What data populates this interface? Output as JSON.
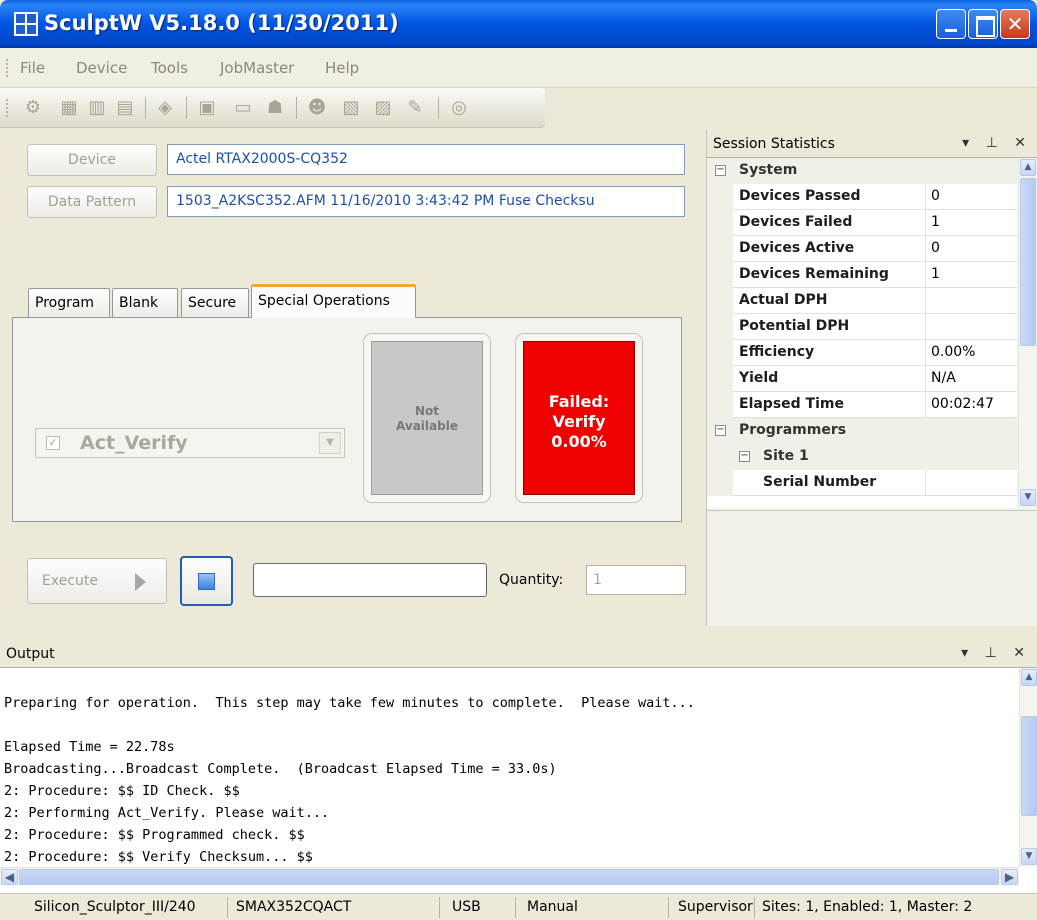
{
  "window": {
    "title": "SculptW  V5.18.0 (11/30/2011)"
  },
  "menu": [
    "File",
    "Device",
    "Tools",
    "JobMaster",
    "Help"
  ],
  "toolbar_icons": [
    "settings-icon",
    "chip-programmer-icon",
    "chip-icon",
    "chip-edit-icon",
    "chip-scan-icon",
    "document-icon",
    "serial-icon",
    "user-icon",
    "operator-icon",
    "open-job-icon",
    "save-job-icon",
    "tools-icon",
    "help-icon"
  ],
  "device": {
    "button_label": "Device",
    "value": "Actel RTAX2000S-CQ352"
  },
  "data_pattern": {
    "button_label": "Data Pattern",
    "value": "1503_A2KSC352.AFM    11/16/2010 3:43:42 PM    Fuse Checksu"
  },
  "tabs": [
    "Program",
    "Blank",
    "Secure",
    "Special Operations"
  ],
  "operation": {
    "selected": "Act_Verify",
    "checked": true
  },
  "cards": {
    "not_available": [
      "Not",
      "Available"
    ],
    "failed": [
      "Failed:",
      "Verify",
      "0.00%"
    ],
    "colors": {
      "failed": "#f10000",
      "not_available": "#c8c8c8"
    }
  },
  "controls": {
    "execute_label": "Execute",
    "quantity_label": "Quantity:",
    "quantity_value": "1",
    "free_text": ""
  },
  "stats": {
    "title": "Session Statistics",
    "system_label": "System",
    "rows": [
      {
        "label": "Devices Passed",
        "value": "0"
      },
      {
        "label": "Devices Failed",
        "value": "1"
      },
      {
        "label": "Devices Active",
        "value": "0"
      },
      {
        "label": "Devices Remaining",
        "value": "1"
      },
      {
        "label": "Actual DPH",
        "value": ""
      },
      {
        "label": "Potential DPH",
        "value": ""
      },
      {
        "label": "Efficiency",
        "value": "0.00%"
      },
      {
        "label": "Yield",
        "value": "N/A"
      },
      {
        "label": "Elapsed Time",
        "value": "00:02:47"
      }
    ],
    "programmers_label": "Programmers",
    "site_label": "Site 1",
    "serial_label": "Serial Number"
  },
  "output": {
    "title": "Output",
    "lines": [
      "Preparing for operation.  This step may take few minutes to complete.  Please wait...",
      "",
      "Elapsed Time = 22.78s",
      "Broadcasting...Broadcast Complete.  (Broadcast Elapsed Time = 33.0s)",
      "2: Procedure: $$ ID Check. $$",
      "2: Performing Act_Verify. Please wait...",
      "2: Procedure: $$ Programmed check. $$",
      "2: Procedure: $$ Verify Checksum... $$"
    ]
  },
  "statusbar": {
    "programmer": "Silicon_Sculptor_III/240",
    "adapter": "SMAX352CQACT",
    "connection": "USB",
    "mode": "Manual",
    "user": "Supervisor",
    "sites": "Sites: 1, Enabled: 1, Master: 2"
  }
}
